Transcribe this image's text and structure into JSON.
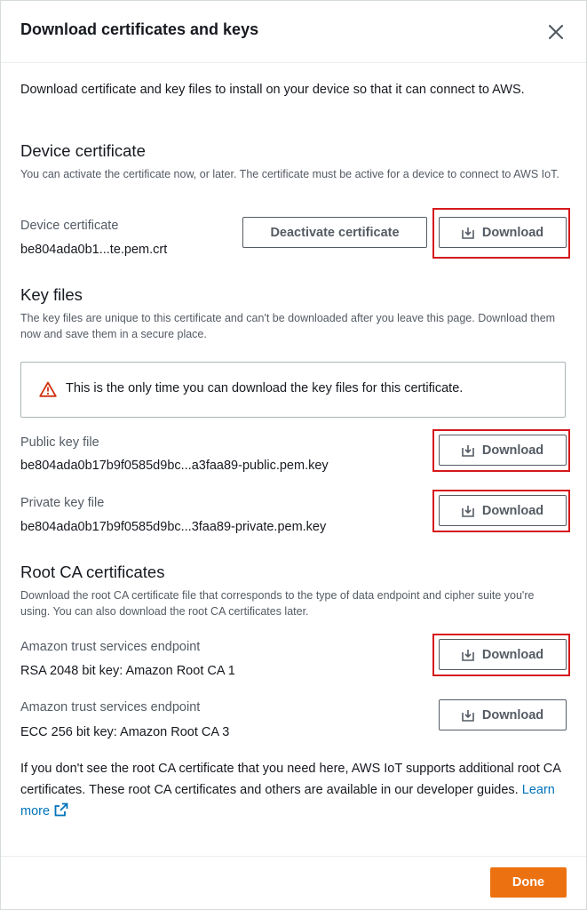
{
  "modal": {
    "title": "Download certificates and keys",
    "intro": "Download certificate and key files to install on your device so that it can connect to AWS."
  },
  "device_certificate": {
    "heading": "Device certificate",
    "description": "You can activate the certificate now, or later. The certificate must be active for a device to connect to AWS IoT.",
    "label": "Device certificate",
    "filename": "be804ada0b1...te.pem.crt",
    "deactivate_label": "Deactivate certificate",
    "download_label": "Download"
  },
  "key_files": {
    "heading": "Key files",
    "description": "The key files are unique to this certificate and can't be downloaded after you leave this page. Download them now and save them in a secure place.",
    "alert": "This is the only time you can download the key files for this certificate.",
    "public_label": "Public key file",
    "public_filename": "be804ada0b17b9f0585d9bc...a3faa89-public.pem.key",
    "private_label": "Private key file",
    "private_filename": "be804ada0b17b9f0585d9bc...3faa89-private.pem.key",
    "download_label": "Download"
  },
  "root_ca": {
    "heading": "Root CA certificates",
    "description": "Download the root CA certificate file that corresponds to the type of data endpoint and cipher suite you're using. You can also download the root CA certificates later.",
    "items": [
      {
        "label": "Amazon trust services endpoint",
        "value": "RSA 2048 bit key: Amazon Root CA 1"
      },
      {
        "label": "Amazon trust services endpoint",
        "value": "ECC 256 bit key: Amazon Root CA 3"
      }
    ],
    "download_label": "Download",
    "footnote": "If you don't see the root CA certificate that you need here, AWS IoT supports additional root CA certificates. These root CA certificates and others are available in our developer guides.",
    "learn_more": "Learn more"
  },
  "footer": {
    "done_label": "Done"
  },
  "colors": {
    "accent": "#ec7211",
    "link": "#0073bb",
    "highlight": "#d5191c",
    "warning": "#d13212"
  }
}
